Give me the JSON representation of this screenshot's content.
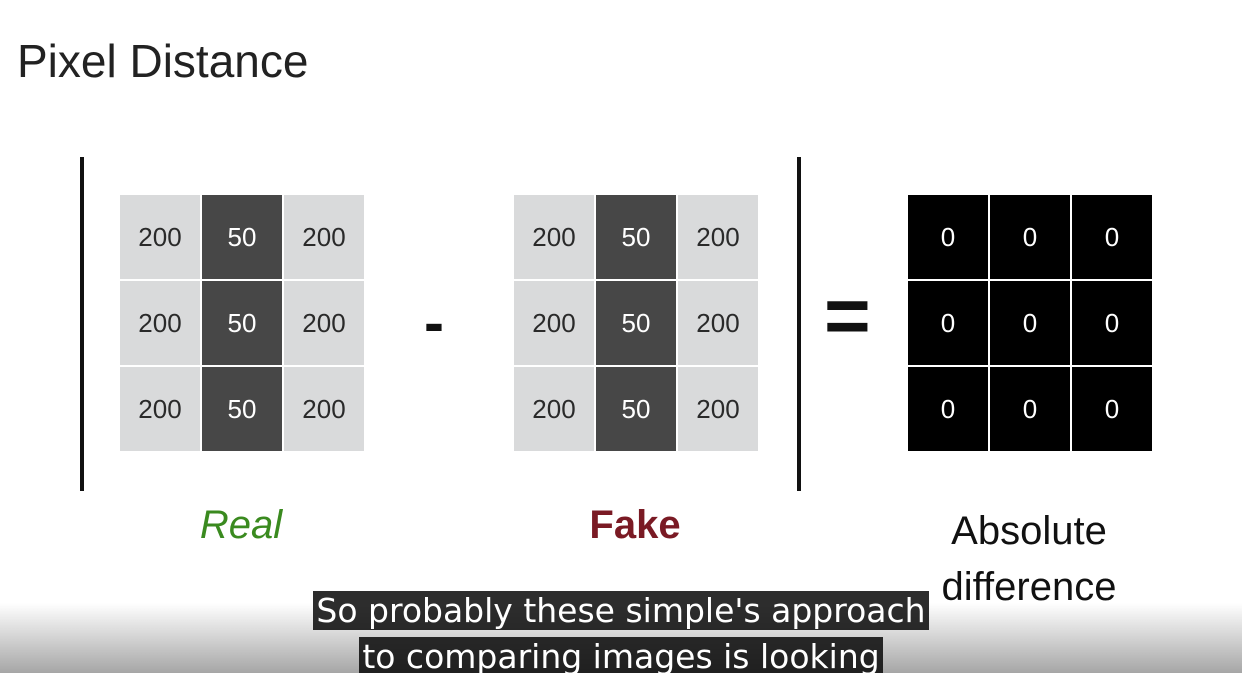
{
  "slide": {
    "title": "Pixel Distance"
  },
  "real_matrix": {
    "rows": [
      [
        "200",
        "50",
        "200"
      ],
      [
        "200",
        "50",
        "200"
      ],
      [
        "200",
        "50",
        "200"
      ]
    ]
  },
  "fake_matrix": {
    "rows": [
      [
        "200",
        "50",
        "200"
      ],
      [
        "200",
        "50",
        "200"
      ],
      [
        "200",
        "50",
        "200"
      ]
    ]
  },
  "diff_matrix": {
    "rows": [
      [
        "0",
        "0",
        "0"
      ],
      [
        "0",
        "0",
        "0"
      ],
      [
        "0",
        "0",
        "0"
      ]
    ]
  },
  "operators": {
    "minus": "-",
    "equals": "="
  },
  "labels": {
    "real": "Real",
    "fake": "Fake",
    "absolute_line1": "Absolute",
    "absolute_line2": "difference"
  },
  "colors": {
    "real_label": "#3a8a1f",
    "fake_label": "#7a1a24",
    "light_cell": "#d9dadb",
    "dark_cell": "#474747",
    "diff_cell": "#000000"
  },
  "subtitles": {
    "line1": "So probably these simple's approach",
    "line2": "to comparing images is looking"
  }
}
